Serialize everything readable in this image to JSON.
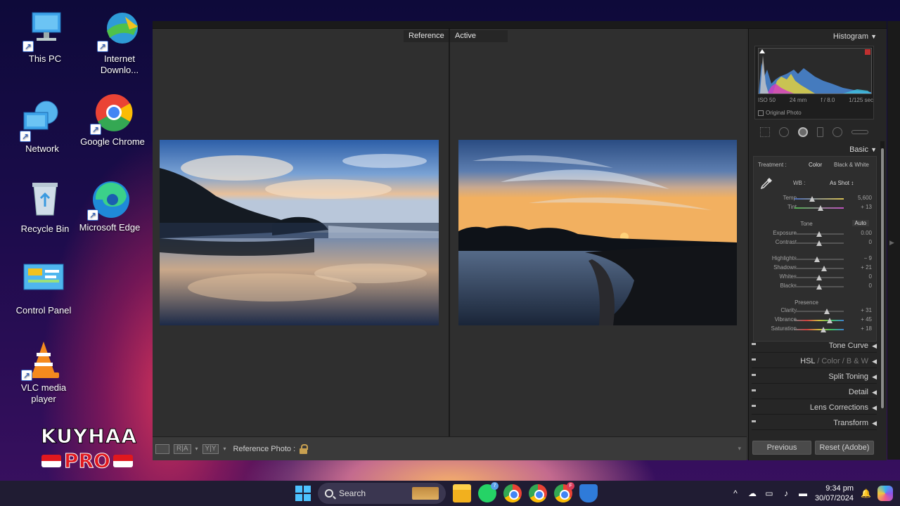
{
  "desktop": {
    "icons": [
      {
        "label": "This PC"
      },
      {
        "label": "Internet Downlo..."
      },
      {
        "label": "Network"
      },
      {
        "label": "Google Chrome"
      },
      {
        "label": "Recycle Bin"
      },
      {
        "label": "Microsoft Edge"
      },
      {
        "label": "Control Panel"
      },
      {
        "label": "VLC media player"
      }
    ],
    "watermark": {
      "line1": "KUYHAA",
      "line2": "PRO"
    }
  },
  "lightroom": {
    "compare": {
      "reference_label": "Reference",
      "active_label": "Active"
    },
    "toolbar": {
      "view_btn_1": "R|A",
      "view_btn_2": "Y|Y",
      "reference_photo_label": "Reference Photo :"
    },
    "histogram": {
      "title": "Histogram",
      "iso": "ISO 50",
      "focal": "24 mm",
      "aperture": "f / 8.0",
      "shutter": "1/125 sec",
      "original_photo": "Original Photo"
    },
    "basic": {
      "title": "Basic",
      "treatment_label": "Treatment :",
      "treatment_color": "Color",
      "treatment_bw": "Black & White",
      "wb_label": "WB :",
      "wb_value": "As Shot",
      "tone_label": "Tone",
      "auto_label": "Auto",
      "presence_label": "Presence",
      "sliders": [
        {
          "label": "Temp",
          "value": "5,600",
          "position": 0.35
        },
        {
          "label": "Tint",
          "value": "+ 13",
          "position": 0.53
        },
        {
          "label": "Exposure",
          "value": "0.00",
          "position": 0.5
        },
        {
          "label": "Contrast",
          "value": "0",
          "position": 0.5
        },
        {
          "label": "Highlights",
          "value": "− 9",
          "position": 0.45
        },
        {
          "label": "Shadows",
          "value": "+ 21",
          "position": 0.6
        },
        {
          "label": "Whites",
          "value": "0",
          "position": 0.5
        },
        {
          "label": "Blacks",
          "value": "0",
          "position": 0.5
        },
        {
          "label": "Clarity",
          "value": "+ 31",
          "position": 0.65
        },
        {
          "label": "Vibrance",
          "value": "+ 45",
          "position": 0.72
        },
        {
          "label": "Saturation",
          "value": "+ 18",
          "position": 0.59
        }
      ]
    },
    "panels": {
      "tone_curve": "Tone Curve",
      "hsl_a": "HSL",
      "hsl_b": "Color",
      "hsl_c": "B & W",
      "split_toning": "Split Toning",
      "detail": "Detail",
      "lens_corrections": "Lens Corrections",
      "transform": "Transform"
    },
    "buttons": {
      "previous": "Previous",
      "reset": "Reset (Adobe)"
    }
  },
  "taskbar": {
    "search_label": "Search",
    "whatsapp_badge": "7",
    "chrome_badge": "F",
    "time": "9:34 pm",
    "date": "30/07/2024"
  },
  "colors": {
    "lr_bg": "#2c2c2c",
    "lr_panel": "#262626",
    "taskbar": "#201c33",
    "windows_accent": "#4cc2ff"
  }
}
